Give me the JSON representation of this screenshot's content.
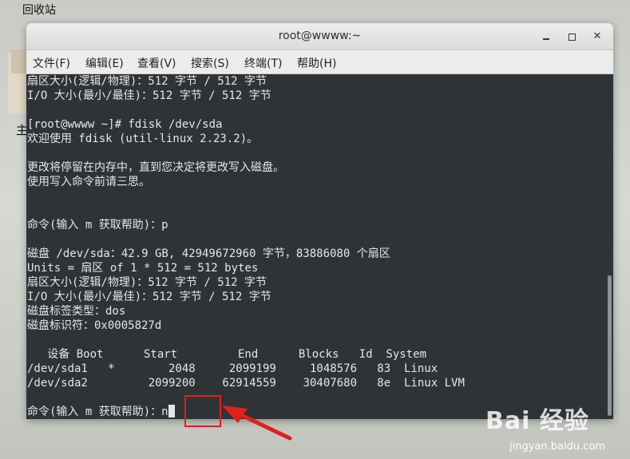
{
  "desktop": {
    "trash_label": "回收站",
    "stray_letter": "主"
  },
  "window": {
    "title": "root@wwww:~",
    "controls": {
      "minimize": "minimize",
      "maximize": "maximize",
      "close": "✕"
    }
  },
  "menu": [
    {
      "label": "文件(F)"
    },
    {
      "label": "编辑(E)"
    },
    {
      "label": "查看(V)"
    },
    {
      "label": "搜索(S)"
    },
    {
      "label": "终端(T)"
    },
    {
      "label": "帮助(H)"
    }
  ],
  "terminal": {
    "lines": [
      "扇区大小(逻辑/物理)：512 字节 / 512 字节",
      "I/O 大小(最小/最佳)：512 字节 / 512 字节",
      "",
      "[root@wwww ~]# fdisk /dev/sda",
      "欢迎使用 fdisk (util-linux 2.23.2)。",
      "",
      "更改将停留在内存中，直到您决定将更改写入磁盘。",
      "使用写入命令前请三思。",
      "",
      "",
      "命令(输入 m 获取帮助)：p",
      "",
      "磁盘 /dev/sda：42.9 GB, 42949672960 字节，83886080 个扇区",
      "Units = 扇区 of 1 * 512 = 512 bytes",
      "扇区大小(逻辑/物理)：512 字节 / 512 字节",
      "I/O 大小(最小/最佳)：512 字节 / 512 字节",
      "磁盘标签类型：dos",
      "磁盘标识符：0x0005827d",
      "",
      "   设备 Boot      Start         End      Blocks   Id  System",
      "/dev/sda1   *        2048     2099199     1048576   83  Linux",
      "/dev/sda2         2099200    62914559    30407680   8e  Linux LVM",
      ""
    ],
    "prompt": "命令(输入 m 获取帮助)：",
    "input": "n"
  },
  "colors": {
    "terminal_bg": "#2e3436",
    "terminal_fg": "#e6e6e6",
    "highlight": "#e0201c"
  },
  "watermark": {
    "main": "Bai  经验",
    "sub": "jingyan.baidu.com"
  }
}
